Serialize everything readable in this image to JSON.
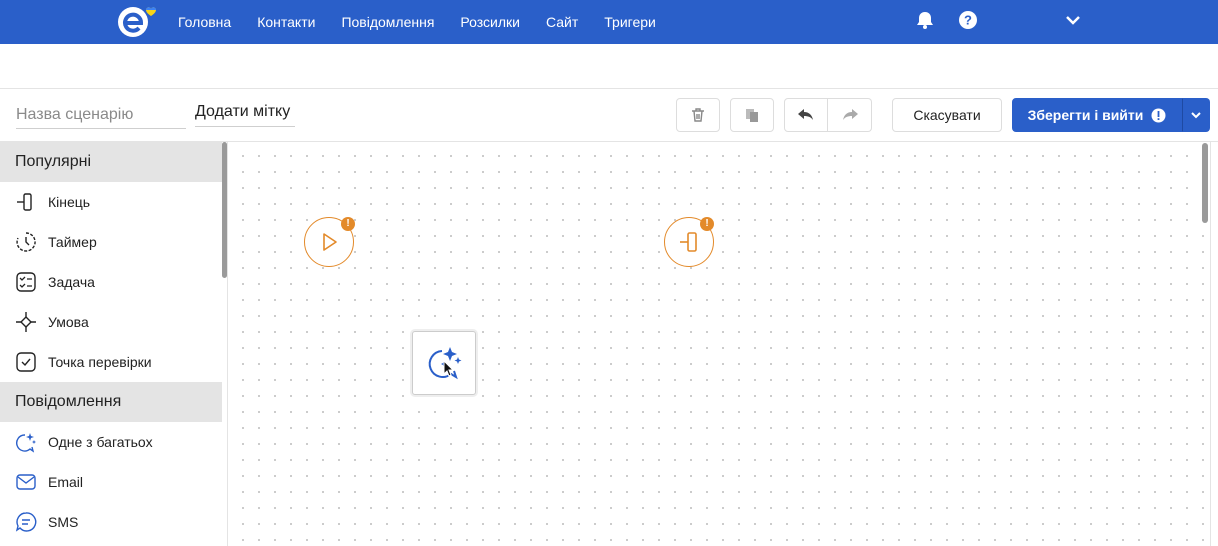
{
  "nav": {
    "items": [
      "Головна",
      "Контакти",
      "Повідомлення",
      "Розсилки",
      "Сайт",
      "Тригери"
    ]
  },
  "toolbar": {
    "name_placeholder": "Назва сценарію",
    "add_tag": "Додати мітку",
    "cancel_label": "Скасувати",
    "save_label": "Зберегти і вийти"
  },
  "sidebar": {
    "sections": [
      {
        "title": "Популярні",
        "items": [
          {
            "label": "Кінець",
            "icon": "end-icon"
          },
          {
            "label": "Таймер",
            "icon": "timer-icon"
          },
          {
            "label": "Задача",
            "icon": "task-icon"
          },
          {
            "label": "Умова",
            "icon": "condition-icon"
          },
          {
            "label": "Точка перевірки",
            "icon": "checkpoint-icon"
          }
        ]
      },
      {
        "title": "Повідомлення",
        "items": [
          {
            "label": "Одне з багатьох",
            "icon": "one-of-many-icon"
          },
          {
            "label": "Email",
            "icon": "email-icon"
          },
          {
            "label": "SMS",
            "icon": "sms-icon"
          }
        ]
      }
    ]
  },
  "canvas": {
    "warning_badge": "!"
  },
  "colors": {
    "brand": "#2a5fc9",
    "warning": "#e38a2a",
    "section_bg": "#e4e4e4"
  }
}
